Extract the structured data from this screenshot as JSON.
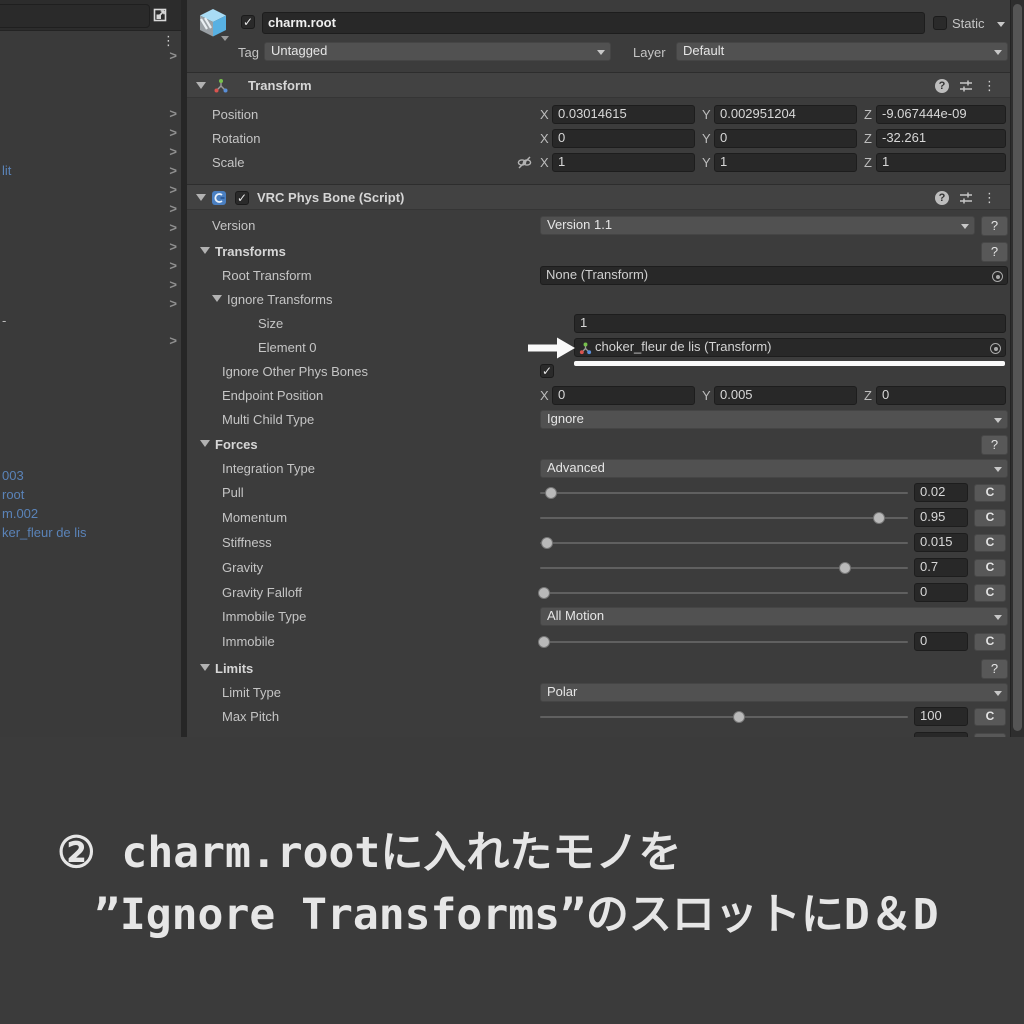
{
  "left_panel": {
    "hierarchy_items": [
      "lit",
      "-",
      "003",
      "root",
      "m.002",
      "ker_fleur de lis"
    ]
  },
  "header": {
    "name": "charm.root",
    "static_label": "Static",
    "tag_label": "Tag",
    "tag_value": "Untagged",
    "layer_label": "Layer",
    "layer_value": "Default"
  },
  "transform": {
    "title": "Transform",
    "axis": {
      "x": "X",
      "y": "Y",
      "z": "Z"
    },
    "position": {
      "label": "Position",
      "x": "0.03014615",
      "y": "0.002951204",
      "z": "-9.067444e-09"
    },
    "rotation": {
      "label": "Rotation",
      "x": "0",
      "y": "0",
      "z": "-32.261"
    },
    "scale": {
      "label": "Scale",
      "x": "1",
      "y": "1",
      "z": "1"
    }
  },
  "physbone": {
    "title": "VRC Phys Bone (Script)",
    "help_label": "?",
    "version": {
      "label": "Version",
      "value": "Version 1.1"
    },
    "transforms_section": {
      "label": "Transforms"
    },
    "root_transform": {
      "label": "Root Transform",
      "value": "None (Transform)"
    },
    "ignore_transforms": {
      "label": "Ignore Transforms"
    },
    "size": {
      "label": "Size",
      "value": "1"
    },
    "element0": {
      "label": "Element 0",
      "value": "choker_fleur de lis (Transform)"
    },
    "ignore_other": {
      "label": "Ignore Other Phys Bones",
      "check": "✓"
    },
    "endpoint": {
      "label": "Endpoint Position",
      "x": "0",
      "y": "0.005",
      "z": "0"
    },
    "multi_child": {
      "label": "Multi Child Type",
      "value": "Ignore"
    },
    "forces_section": {
      "label": "Forces"
    },
    "integration": {
      "label": "Integration Type",
      "value": "Advanced"
    },
    "pull": {
      "label": "Pull",
      "value": "0.02",
      "pct": 3,
      "c": "C"
    },
    "momentum": {
      "label": "Momentum",
      "value": "0.95",
      "pct": 92,
      "c": "C"
    },
    "stiffness": {
      "label": "Stiffness",
      "value": "0.015",
      "pct": 2,
      "c": "C"
    },
    "gravity": {
      "label": "Gravity",
      "value": "0.7",
      "pct": 83,
      "c": "C"
    },
    "gravity_falloff": {
      "label": "Gravity Falloff",
      "value": "0",
      "pct": 1,
      "c": "C"
    },
    "immobile_type": {
      "label": "Immobile Type",
      "value": "All Motion"
    },
    "immobile": {
      "label": "Immobile",
      "value": "0",
      "pct": 1,
      "c": "C"
    },
    "limits_section": {
      "label": "Limits"
    },
    "limit_type": {
      "label": "Limit Type",
      "value": "Polar"
    },
    "max_pitch": {
      "label": "Max Pitch",
      "value": "100",
      "pct": 54,
      "c": "C"
    }
  },
  "caption": {
    "line1": "② charm.rootに入れたモノを",
    "line2": "”Ignore Transforms”のスロットにD＆D"
  }
}
